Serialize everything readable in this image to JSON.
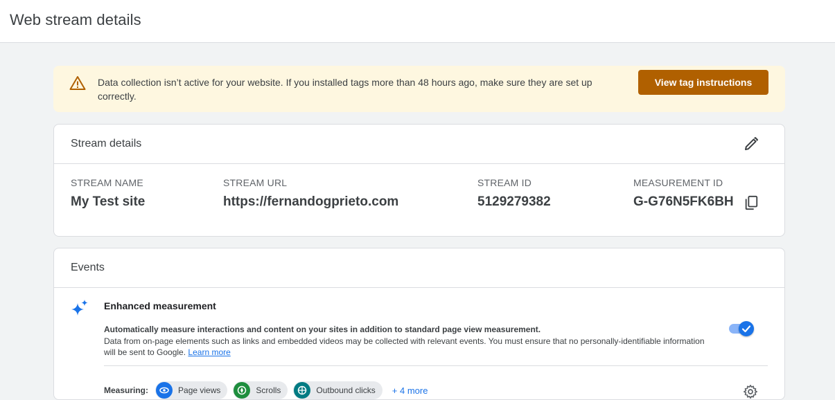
{
  "header": {
    "title": "Web stream details"
  },
  "alert": {
    "icon": "warning-icon",
    "message": "Data collection isn’t active for your website. If you installed tags more than 48 hours ago, make sure they are set up correctly.",
    "button_label": "View tag instructions",
    "colors": {
      "background": "#fef7e0",
      "button": "#b06000"
    }
  },
  "stream_details": {
    "title": "Stream details",
    "edit_icon": "pencil-icon",
    "fields": [
      {
        "label": "STREAM NAME",
        "value": "My Test site"
      },
      {
        "label": "STREAM URL",
        "value": "https://fernandogprieto.com"
      },
      {
        "label": "STREAM ID",
        "value": "5129279382"
      },
      {
        "label": "MEASUREMENT ID",
        "value": "G-G76N5FK6BH"
      }
    ],
    "copy_icon": "copy-icon"
  },
  "events": {
    "title": "Events",
    "enhanced": {
      "icon": "sparkle-icon",
      "title": "Enhanced measurement",
      "desc_bold": "Automatically measure interactions and content on your sites in addition to standard page view measurement.",
      "desc": "Data from on-page elements such as links and embedded videos may be collected with relevant events. You must ensure that no personally-identifiable information will be sent to Google.",
      "learn_more": "Learn more",
      "toggle_on": true
    },
    "measuring": {
      "label": "Measuring:",
      "chips": [
        {
          "label": "Page views",
          "icon": "eye-icon",
          "color": "#1a73e8"
        },
        {
          "label": "Scrolls",
          "icon": "compass-icon",
          "color": "#1e8e3e"
        },
        {
          "label": "Outbound clicks",
          "icon": "globe-icon",
          "color": "#007b83"
        }
      ],
      "more": "+ 4 more"
    },
    "settings_icon": "gear-icon"
  }
}
